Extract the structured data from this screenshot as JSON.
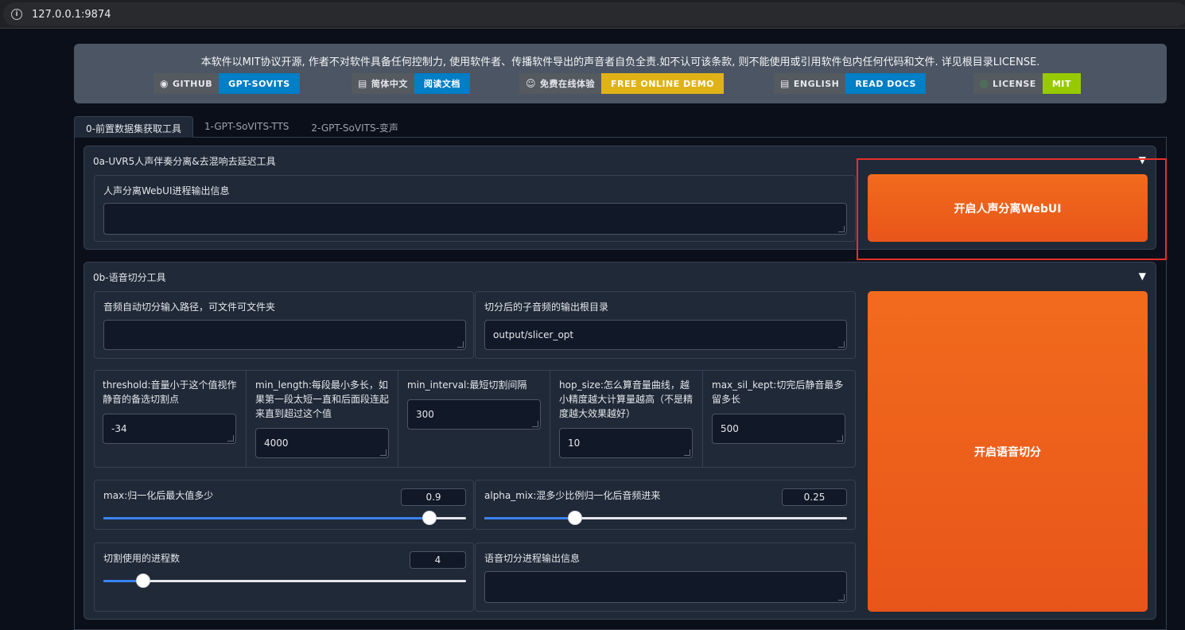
{
  "browser": {
    "url": "127.0.0.1:9874"
  },
  "banner": {
    "text": "本软件以MIT协议开源, 作者不对软件具备任何控制力, 使用软件者、传播软件导出的声音者自负全责.如不认可该条款, 则不能使用或引用软件包内任何代码和文件. 详见根目录LICENSE.",
    "badges": [
      {
        "label": "GITHUB",
        "value": "GPT-SOVITS",
        "color": "#007ec6",
        "icon": "github-icon"
      },
      {
        "label": "简体中文",
        "value": "阅读文档",
        "color": "#007ec6",
        "icon": "document-icon"
      },
      {
        "label": "免费在线体验",
        "value": "FREE ONLINE DEMO",
        "color": "#dfb317",
        "icon": "hugging-face-icon"
      },
      {
        "label": "ENGLISH",
        "value": "READ DOCS",
        "color": "#007ec6",
        "icon": "document-icon"
      },
      {
        "label": "LICENSE",
        "value": "MIT",
        "color": "#97ca00",
        "icon": "license-icon"
      }
    ]
  },
  "tabs": [
    "0-前置数据集获取工具",
    "1-GPT-SoVITS-TTS",
    "2-GPT-SoVITS-变声"
  ],
  "uvr": {
    "title": "0a-UVR5人声伴奏分离&去混响去延迟工具",
    "output_label": "人声分离WebUI进程输出信息",
    "output_value": "",
    "button": "开启人声分离WebUI"
  },
  "slicer": {
    "title": "0b-语音切分工具",
    "input_path_label": "音频自动切分输入路径，可文件可文件夹",
    "input_path_value": "",
    "output_dir_label": "切分后的子音频的输出根目录",
    "output_dir_value": "output/slicer_opt",
    "threshold_label": "threshold:音量小于这个值视作静音的备选切割点",
    "threshold_value": "-34",
    "min_length_label": "min_length:每段最小多长，如果第一段太短一直和后面段连起来直到超过这个值",
    "min_length_value": "4000",
    "min_interval_label": "min_interval:最短切割间隔",
    "min_interval_value": "300",
    "hop_size_label": "hop_size:怎么算音量曲线，越小精度越大计算量越高（不是精度越大效果越好）",
    "hop_size_value": "10",
    "max_sil_label": "max_sil_kept:切完后静音最多留多长",
    "max_sil_value": "500",
    "max_label": "max:归一化后最大值多少",
    "max_value": "0.9",
    "max_fraction": 0.9,
    "alpha_label": "alpha_mix:混多少比例归一化后音频进来",
    "alpha_value": "0.25",
    "alpha_fraction": 0.25,
    "procs_label": "切割使用的进程数",
    "procs_value": "4",
    "procs_fraction": 0.11,
    "status_label": "语音切分进程输出信息",
    "status_value": "",
    "button": "开启语音切分"
  }
}
